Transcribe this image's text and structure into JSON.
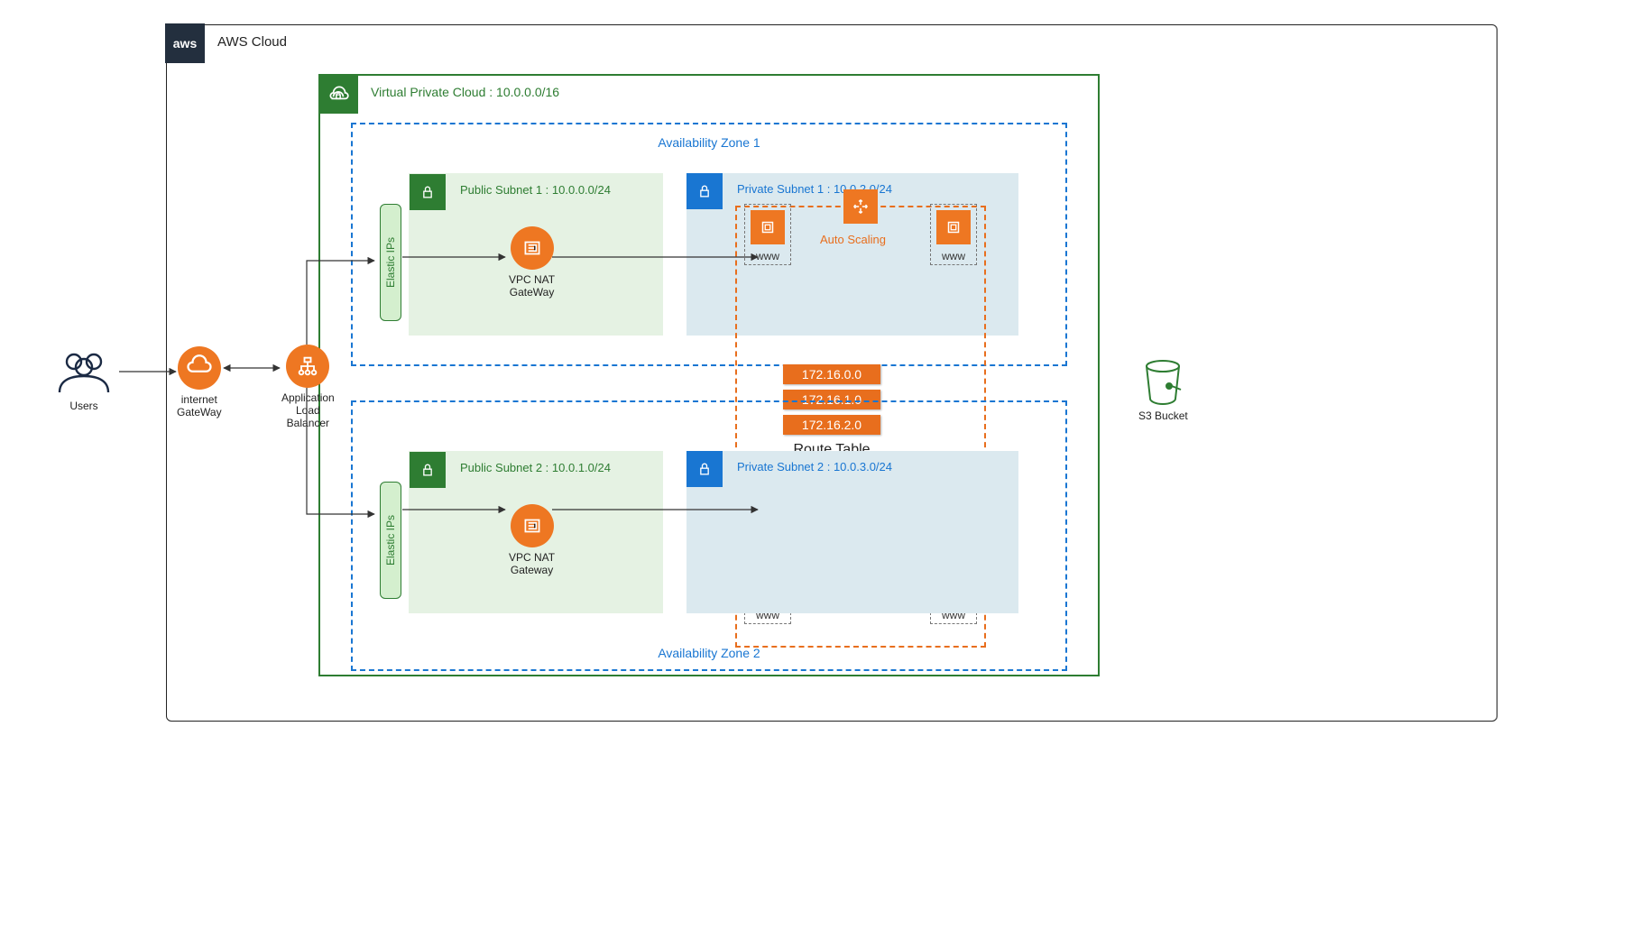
{
  "cloud": {
    "label": "AWS Cloud",
    "badge": "aws"
  },
  "vpc": {
    "label": "Virtual Private Cloud : 10.0.0.0/16"
  },
  "az": {
    "zone1": "Availability Zone 1",
    "zone2": "Availability Zone 2"
  },
  "subnets": {
    "public1": "Public Subnet 1 : 10.0.0.0/24",
    "private1": "Private Subnet 1 : 10.0.2.0/24",
    "public2": "Public Subnet 2 : 10.0.1.0/24",
    "private2": "Private Subnet 2 : 10.0.3.0/24"
  },
  "elastic_ips": {
    "label": "Elastic IPs"
  },
  "nat": {
    "label1": "VPC NAT\nGateWay",
    "label2": "VPC NAT\nGateway"
  },
  "route_table": {
    "label": "Route Table",
    "routes": [
      "172.16.0.0",
      "172.16.1.0",
      "172.16.2.0"
    ]
  },
  "asg": {
    "label": "Auto Scaling"
  },
  "instance": {
    "www": "www"
  },
  "external": {
    "users": "Users",
    "igw": "internet\nGateWay",
    "alb": "Application\nLoad\nBalancer",
    "s3": "S3 Bucket"
  }
}
